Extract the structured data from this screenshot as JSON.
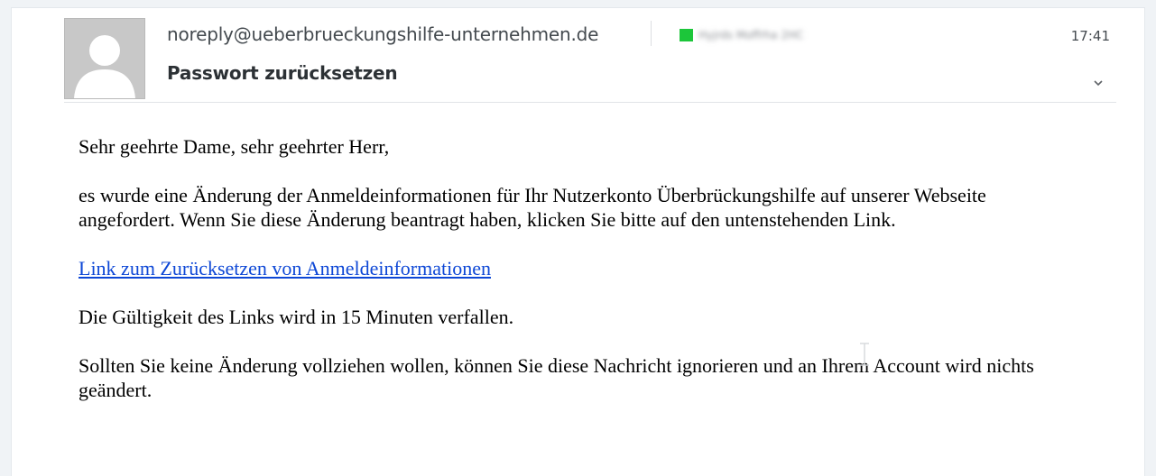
{
  "header": {
    "sender": "noreply@ueberbrueckungshilfe-unternehmen.de",
    "recipient_name": "Hyjrds Moffrha 2HC",
    "recipient_badge_color": "#1cc63a",
    "time": "17:41",
    "subject": "Passwort zurücksetzen",
    "avatar_icon": "person-placeholder-icon",
    "expand_icon": "chevron-down-icon"
  },
  "body": {
    "greeting": "Sehr geehrte Dame, sehr geehrter Herr,",
    "paragraph_1": "es wurde eine Änderung der Anmeldeinformationen für Ihr Nutzerkonto Überbrückungshilfe auf unserer Webseite angefordert. Wenn Sie diese Änderung beantragt haben, klicken Sie bitte auf den untenstehenden Link.",
    "reset_link": "Link zum Zurücksetzen von Anmeldeinformationen",
    "validity": "Die Gültigkeit des Links wird in 15 Minuten verfallen.",
    "closing": "Sollten Sie keine Änderung vollziehen wollen, können Sie diese Nachricht ignorieren und an Ihrem Account wird nichts geändert."
  },
  "colors": {
    "page_background": "#f0f3f6",
    "link": "#0d47d6",
    "avatar_background": "#c8c8c8"
  }
}
